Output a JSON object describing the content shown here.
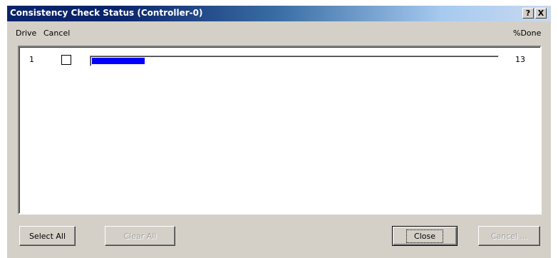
{
  "window": {
    "title": "Consistency Check Status (Controller-0)",
    "help_glyph": "?",
    "close_glyph": "X"
  },
  "columns": {
    "drive": "Drive",
    "cancel": "Cancel",
    "percent_done": "%Done"
  },
  "rows": [
    {
      "drive": "1",
      "cancel_checked": false,
      "progress_percent": 13,
      "percent_done": "13"
    }
  ],
  "buttons": {
    "select_all": "Select All",
    "clear_all": "Clear All",
    "close": "Close",
    "cancel": "Cancel ..."
  },
  "colors": {
    "title_bar": "#0a246a",
    "progress_fill": "#0000ff",
    "face": "#d4d0c8"
  }
}
